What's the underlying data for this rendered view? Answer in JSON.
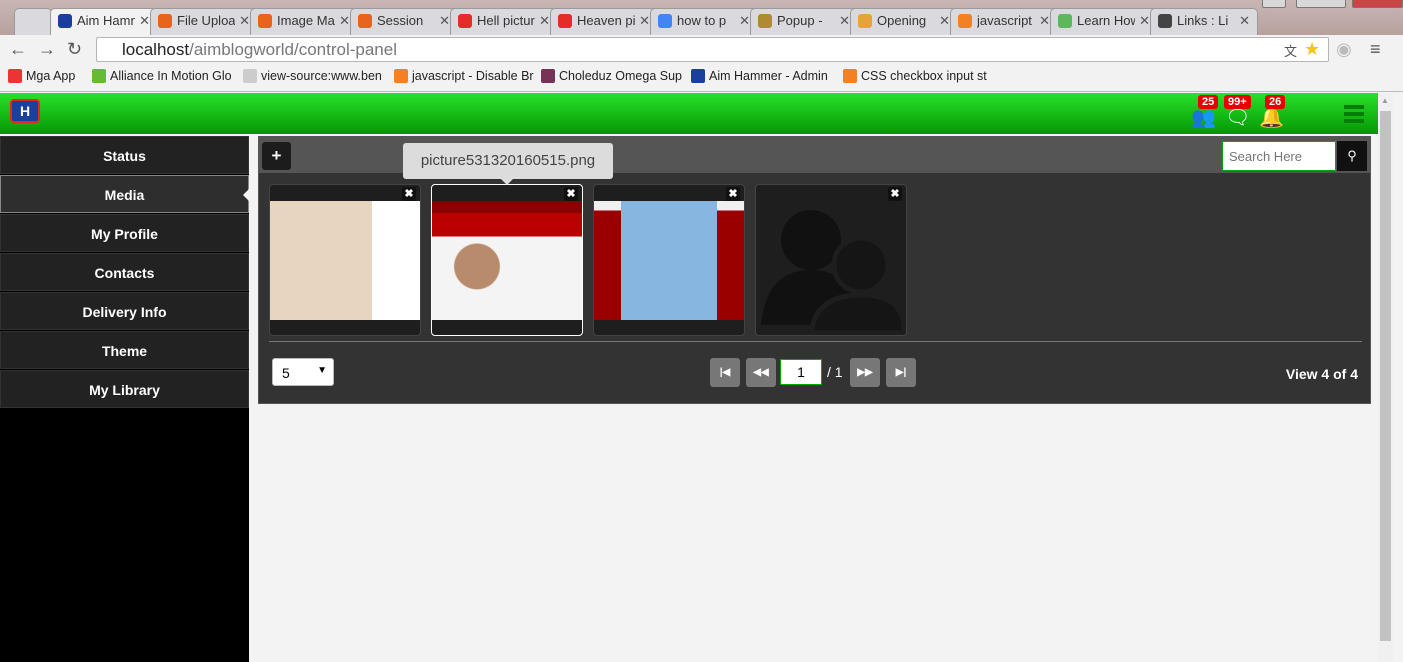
{
  "browser": {
    "tabs": [
      {
        "label": "",
        "color": "#d9d9de"
      },
      {
        "label": "Aim Hammer",
        "color": "#1b3f9c",
        "active": true
      },
      {
        "label": "File Upload",
        "color": "#e8641c"
      },
      {
        "label": "Image Manager",
        "color": "#e8641c"
      },
      {
        "label": "Session",
        "color": "#e8641c"
      },
      {
        "label": "Hell picture",
        "color": "#e52d27"
      },
      {
        "label": "Heaven picture",
        "color": "#e52d27"
      },
      {
        "label": "how to p",
        "color": "#4285f4"
      },
      {
        "label": "Popup -",
        "color": "#b08a30"
      },
      {
        "label": "Opening",
        "color": "#e8a23a"
      },
      {
        "label": "javascript",
        "color": "#f48024"
      },
      {
        "label": "Learn How",
        "color": "#5cb85c"
      },
      {
        "label": "Links : Li",
        "color": "#444"
      }
    ],
    "url_host": "localhost",
    "url_path": "/aimblogworld/control-panel",
    "bookmarks": [
      {
        "label": "Mga App",
        "color": "#e33"
      },
      {
        "label": "Alliance In Motion Glo",
        "color": "#6b3"
      },
      {
        "label": "view-source:www.ben",
        "color": "#ccc"
      },
      {
        "label": "javascript - Disable Br",
        "color": "#f48024"
      },
      {
        "label": "Choleduz Omega Sup",
        "color": "#735"
      },
      {
        "label": "Aim Hammer - Admin",
        "color": "#1b3f9c"
      },
      {
        "label": "CSS checkbox input st",
        "color": "#f48024"
      }
    ]
  },
  "header": {
    "logo": "H",
    "badges": {
      "users": "25",
      "messages": "99+",
      "notifications": "26"
    }
  },
  "sidebar": {
    "items": [
      "Status",
      "Media",
      "My Profile",
      "Contacts",
      "Delivery Info",
      "Theme",
      "My Library"
    ],
    "active": "Media"
  },
  "media": {
    "add_label": "+",
    "search_placeholder": "Search Here",
    "tooltip": "picture531320160515.png",
    "thumbs": [
      {
        "kind": "shop"
      },
      {
        "kind": "video"
      },
      {
        "kind": "building"
      },
      {
        "kind": "placeholder"
      }
    ],
    "per_page": "5",
    "page": "1",
    "page_total": "/ 1",
    "view_text": "View 4 of 4"
  }
}
